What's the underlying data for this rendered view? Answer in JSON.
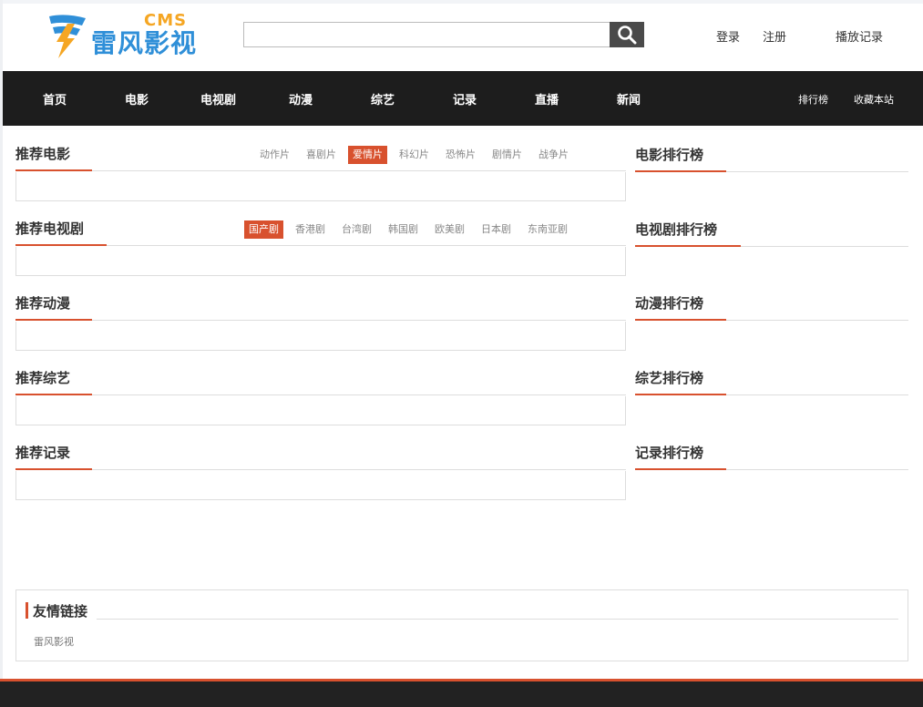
{
  "header": {
    "logo_cms": "CMS",
    "logo_name": "雷风影视",
    "search_value": "",
    "search_icon": "search-icon",
    "links": [
      "登录",
      "注册",
      "播放记录"
    ]
  },
  "nav": {
    "items": [
      "首页",
      "电影",
      "电视剧",
      "动漫",
      "综艺",
      "记录",
      "直播",
      "新闻"
    ],
    "right": [
      "排行榜",
      "收藏本站"
    ]
  },
  "sections": [
    {
      "title": "推荐电影",
      "tabs": [
        "动作片",
        "喜剧片",
        "爱情片",
        "科幻片",
        "恐怖片",
        "剧情片",
        "战争片"
      ],
      "active_tab": "爱情片"
    },
    {
      "title": "推荐电视剧",
      "tabs": [
        "国产剧",
        "香港剧",
        "台湾剧",
        "韩国剧",
        "欧美剧",
        "日本剧",
        "东南亚剧"
      ],
      "active_tab": "国产剧"
    },
    {
      "title": "推荐动漫"
    },
    {
      "title": "推荐综艺"
    },
    {
      "title": "推荐记录"
    }
  ],
  "rankings": [
    "电影排行榜",
    "电视剧排行榜",
    "动漫排行榜",
    "综艺排行榜",
    "记录排行榜"
  ],
  "friends": {
    "title": "友情链接",
    "links": [
      "雷风影视"
    ]
  },
  "colors": {
    "accent": "#d8512e",
    "nav_bg": "#1d1d1d",
    "logo_blue": "#2f8fd8",
    "logo_orange": "#f5a623"
  }
}
